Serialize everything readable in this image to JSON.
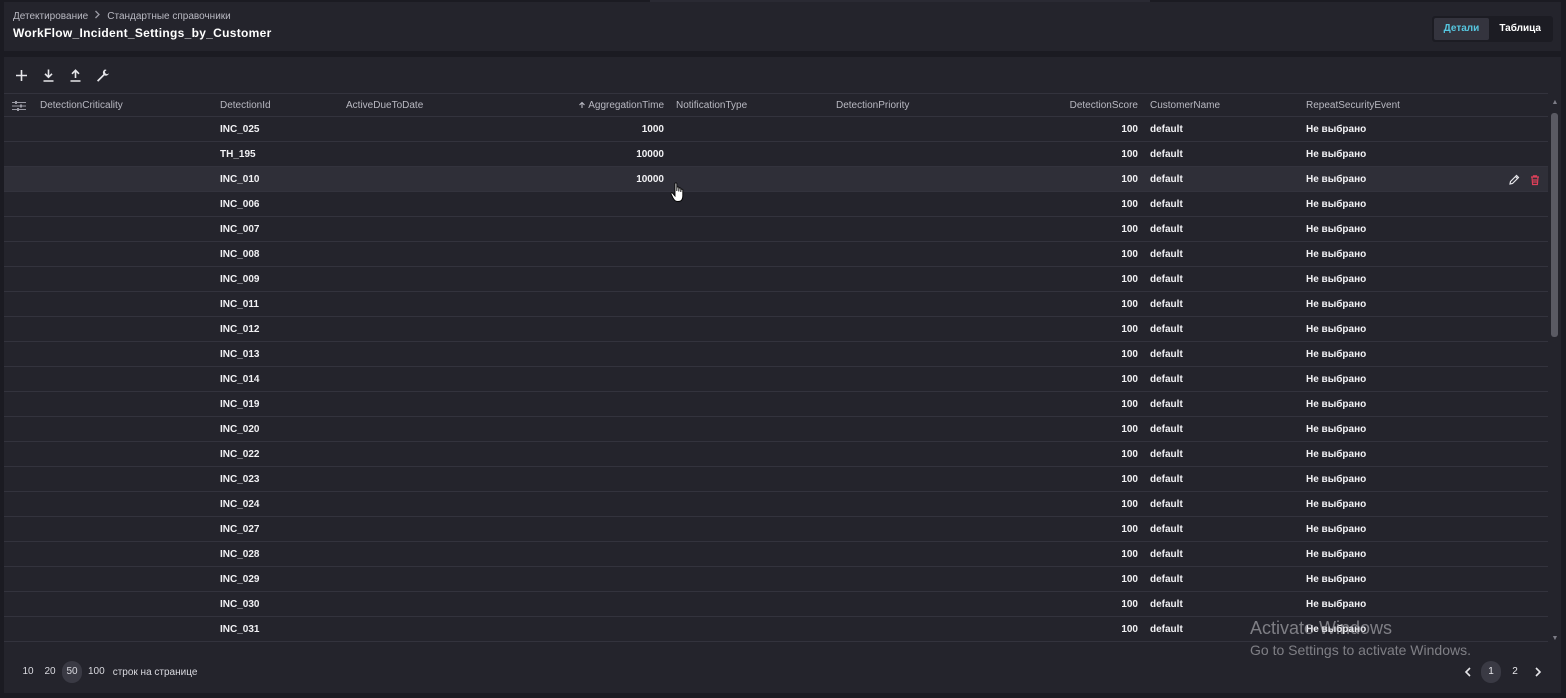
{
  "breadcrumb": {
    "parent": "Детектирование",
    "current": "Стандартные справочники"
  },
  "page_title": "WorkFlow_Incident_Settings_by_Customer",
  "view_toggle": {
    "details": "Детали",
    "table": "Таблица"
  },
  "toolbar_icons": [
    "add-icon",
    "download-icon",
    "upload-icon",
    "wrench-icon"
  ],
  "columns": {
    "detection_criticality": "DetectionCriticality",
    "detection_id": "DetectionId",
    "active_due_to_date": "ActiveDueToDate",
    "aggregation_time": "AggregationTime",
    "notification_type": "NotificationType",
    "detection_priority": "DetectionPriority",
    "detection_score": "DetectionScore",
    "customer_name": "CustomerName",
    "repeat_security_event": "RepeatSecurityEvent"
  },
  "sort": {
    "column": "AggregationTime",
    "direction": "ascending"
  },
  "rows": [
    {
      "detection_id": "INC_025",
      "aggregation_time": "1000",
      "detection_score": "100",
      "customer_name": "default",
      "repeat_security_event": "Не выбрано"
    },
    {
      "detection_id": "TH_195",
      "aggregation_time": "10000",
      "detection_score": "100",
      "customer_name": "default",
      "repeat_security_event": "Не выбрано"
    },
    {
      "detection_id": "INC_010",
      "aggregation_time": "10000",
      "detection_score": "100",
      "customer_name": "default",
      "repeat_security_event": "Не выбрано"
    },
    {
      "detection_id": "INC_006",
      "aggregation_time": "",
      "detection_score": "100",
      "customer_name": "default",
      "repeat_security_event": "Не выбрано"
    },
    {
      "detection_id": "INC_007",
      "aggregation_time": "",
      "detection_score": "100",
      "customer_name": "default",
      "repeat_security_event": "Не выбрано"
    },
    {
      "detection_id": "INC_008",
      "aggregation_time": "",
      "detection_score": "100",
      "customer_name": "default",
      "repeat_security_event": "Не выбрано"
    },
    {
      "detection_id": "INC_009",
      "aggregation_time": "",
      "detection_score": "100",
      "customer_name": "default",
      "repeat_security_event": "Не выбрано"
    },
    {
      "detection_id": "INC_011",
      "aggregation_time": "",
      "detection_score": "100",
      "customer_name": "default",
      "repeat_security_event": "Не выбрано"
    },
    {
      "detection_id": "INC_012",
      "aggregation_time": "",
      "detection_score": "100",
      "customer_name": "default",
      "repeat_security_event": "Не выбрано"
    },
    {
      "detection_id": "INC_013",
      "aggregation_time": "",
      "detection_score": "100",
      "customer_name": "default",
      "repeat_security_event": "Не выбрано"
    },
    {
      "detection_id": "INC_014",
      "aggregation_time": "",
      "detection_score": "100",
      "customer_name": "default",
      "repeat_security_event": "Не выбрано"
    },
    {
      "detection_id": "INC_019",
      "aggregation_time": "",
      "detection_score": "100",
      "customer_name": "default",
      "repeat_security_event": "Не выбрано"
    },
    {
      "detection_id": "INC_020",
      "aggregation_time": "",
      "detection_score": "100",
      "customer_name": "default",
      "repeat_security_event": "Не выбрано"
    },
    {
      "detection_id": "INC_022",
      "aggregation_time": "",
      "detection_score": "100",
      "customer_name": "default",
      "repeat_security_event": "Не выбрано"
    },
    {
      "detection_id": "INC_023",
      "aggregation_time": "",
      "detection_score": "100",
      "customer_name": "default",
      "repeat_security_event": "Не выбрано"
    },
    {
      "detection_id": "INC_024",
      "aggregation_time": "",
      "detection_score": "100",
      "customer_name": "default",
      "repeat_security_event": "Не выбрано"
    },
    {
      "detection_id": "INC_027",
      "aggregation_time": "",
      "detection_score": "100",
      "customer_name": "default",
      "repeat_security_event": "Не выбрано"
    },
    {
      "detection_id": "INC_028",
      "aggregation_time": "",
      "detection_score": "100",
      "customer_name": "default",
      "repeat_security_event": "Не выбрано"
    },
    {
      "detection_id": "INC_029",
      "aggregation_time": "",
      "detection_score": "100",
      "customer_name": "default",
      "repeat_security_event": "Не выбрано"
    },
    {
      "detection_id": "INC_030",
      "aggregation_time": "",
      "detection_score": "100",
      "customer_name": "default",
      "repeat_security_event": "Не выбрано"
    },
    {
      "detection_id": "INC_031",
      "aggregation_time": "",
      "detection_score": "100",
      "customer_name": "default",
      "repeat_security_event": "Не выбрано"
    }
  ],
  "hovered_row": 2,
  "footer": {
    "page_sizes": [
      "10",
      "20",
      "50",
      "100"
    ],
    "selected_page_size": "50",
    "rows_per_page_label": "строк на странице",
    "pages": [
      "1",
      "2"
    ],
    "current_page": "1"
  },
  "watermark": {
    "title": "Activate Windows",
    "subtitle": "Go to Settings to activate Windows."
  },
  "colors": {
    "background": "#1b1b22",
    "panel": "#24242c",
    "accent": "#56c7e0",
    "delete": "#e0405a"
  }
}
